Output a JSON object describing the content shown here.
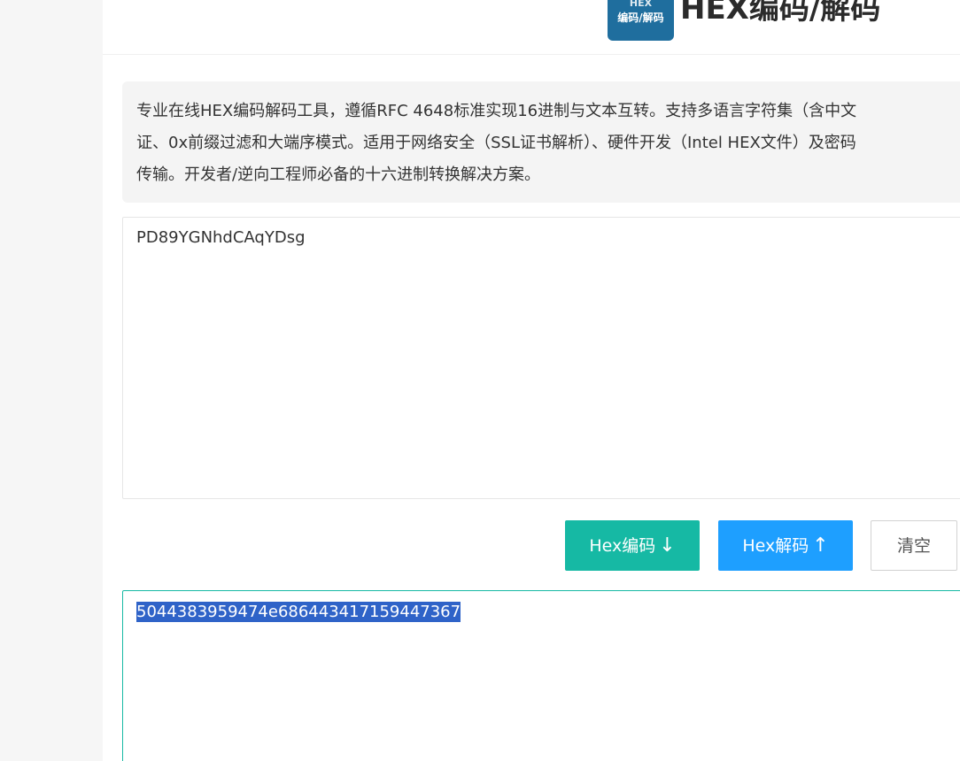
{
  "header": {
    "logo_top": "HEX",
    "logo_bottom": "编码/解码",
    "title": "HEX编码/解码"
  },
  "description": {
    "lines": [
      "专业在线HEX编码解码工具，遵循RFC 4648标准实现16进制与文本互转。支持多语言字符集（含中文",
      "证、0x前缀过滤和大端序模式。适用于网络安全（SSL证书解析）、硬件开发（Intel HEX文件）及密码",
      "传输。开发者/逆向工程师必备的十六进制转换解决方案。"
    ]
  },
  "input": {
    "value": "PD89YGNhdCAqYDsg"
  },
  "buttons": {
    "encode_label": "Hex编码",
    "encode_arrow": "↓",
    "decode_label": "Hex解码",
    "decode_arrow": "↑",
    "clear_label": "清空"
  },
  "output": {
    "value": "5044383959474e686443417159447367"
  },
  "colors": {
    "encode_button": "#16b9a4",
    "decode_button": "#1e9fff",
    "logo_background": "#1f6e9e",
    "selection": "#2f63c8"
  }
}
